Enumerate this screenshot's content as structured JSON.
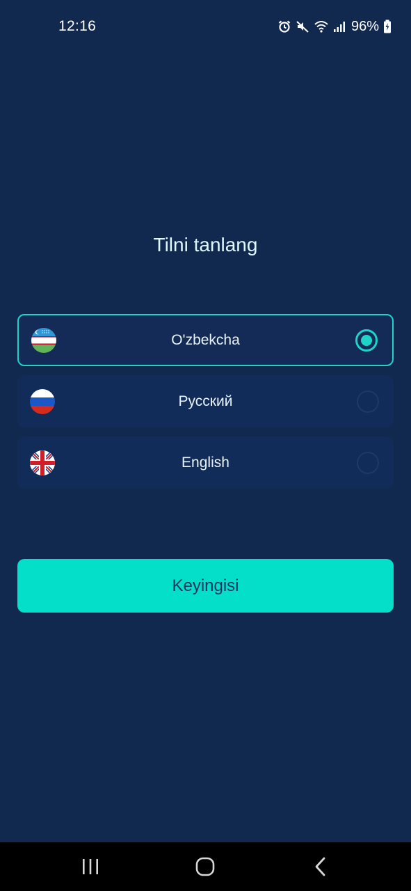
{
  "status_bar": {
    "time": "12:16",
    "battery": "96%",
    "icons": [
      "alarm-icon",
      "mute-icon",
      "wifi-icon",
      "signal-icon",
      "battery-charging-icon"
    ]
  },
  "screen": {
    "title": "Tilni tanlang"
  },
  "languages": [
    {
      "label": "O'zbekcha",
      "flag": "uzbekistan-flag-icon",
      "selected": true
    },
    {
      "label": "Русский",
      "flag": "russia-flag-icon",
      "selected": false
    },
    {
      "label": "English",
      "flag": "uk-flag-icon",
      "selected": false
    }
  ],
  "next_button": {
    "label": "Keyingisi"
  },
  "nav_bar": {
    "icons": [
      "recents-icon",
      "home-icon",
      "back-icon"
    ]
  },
  "colors": {
    "background": "#12294f",
    "accent": "#03dfc8",
    "option_bg": "#112c58"
  }
}
